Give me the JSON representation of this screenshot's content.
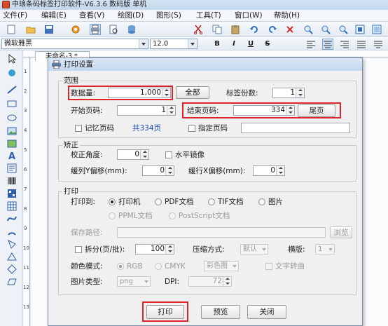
{
  "app": {
    "title": "中琅条码标签打印软件-V6.3.6 数码版 单机",
    "menus": [
      "文件(F)",
      "编辑(E)",
      "查看(V)",
      "绘图(D)",
      "图形(S)",
      "工具(T)",
      "窗口(W)",
      "帮助(H)"
    ],
    "toolbar_icons": [
      "new-icon",
      "open-icon",
      "save-icon",
      "settings-icon",
      "print-icon",
      "print-preview-icon",
      "database-icon",
      "cut-icon",
      "copy-icon",
      "paste-icon",
      "undo-icon",
      "redo-icon",
      "delete-icon",
      "zoom-in-icon",
      "zoom-out-icon",
      "zoom-fit-icon",
      "zoom-actual-icon",
      "zoom-page-icon",
      "grid-icon"
    ],
    "font_name": "微软雅黑",
    "font_size": "12.0",
    "format_bold": "B",
    "format_italic": "I",
    "format_underline": "U",
    "format_strike": "S",
    "doc_tab": "未命名-3 *",
    "ruler_numbers": [
      "1",
      "2",
      "3",
      "4",
      "5",
      "6",
      "7",
      "8",
      "9",
      "10",
      "11",
      "12",
      "13"
    ]
  },
  "dialog": {
    "title": "打印设置",
    "range": {
      "title": "范围",
      "data_qty_label": "数据量:",
      "data_qty_value": "1,000",
      "all_button": "全部",
      "label_copies_label": "标签份数:",
      "label_copies_value": "1",
      "start_page_label": "开始页码:",
      "start_page_value": "1",
      "end_page_label": "结束页码:",
      "end_page_value": "334",
      "last_page_button": "尾页",
      "remember_page_label": "记忆页码",
      "total_pages_text": "共334页",
      "specify_page_label": "指定页码"
    },
    "correction": {
      "title": "矫正",
      "angle_label": "校正角度:",
      "angle_value": "0",
      "mirror_label": "水平镜像",
      "offset_y_label": "缓列Y偏移(mm):",
      "offset_y_value": "0",
      "offset_x_label": "缓行X偏移(mm):",
      "offset_x_value": "0"
    },
    "print": {
      "title": "打印",
      "print_to_label": "打印到:",
      "options": [
        "打印机",
        "PDF文档",
        "TIF文档",
        "图片"
      ],
      "options_row2": [
        "PPML文档",
        "PostScript文档"
      ],
      "save_path_label": "保存路径:",
      "browse_button": "浏览",
      "split_label": "拆分(页/批):",
      "split_value": "100",
      "compress_label": "压缩方式:",
      "compress_value": "默认",
      "layout_label": "横版:",
      "layout_value": "1",
      "color_mode_label": "颜色模式:",
      "color_rgb": "RGB",
      "color_cmyk": "CMYK",
      "color_select": "彩色图",
      "text_convert_label": "文字转曲",
      "image_type_label": "图片类型:",
      "image_type_value": "png",
      "dpi_label": "DPI:",
      "dpi_value": "72"
    },
    "buttons": {
      "print": "打印",
      "preview": "预览",
      "close": "关闭"
    },
    "highlight_color": "#e0242b"
  }
}
